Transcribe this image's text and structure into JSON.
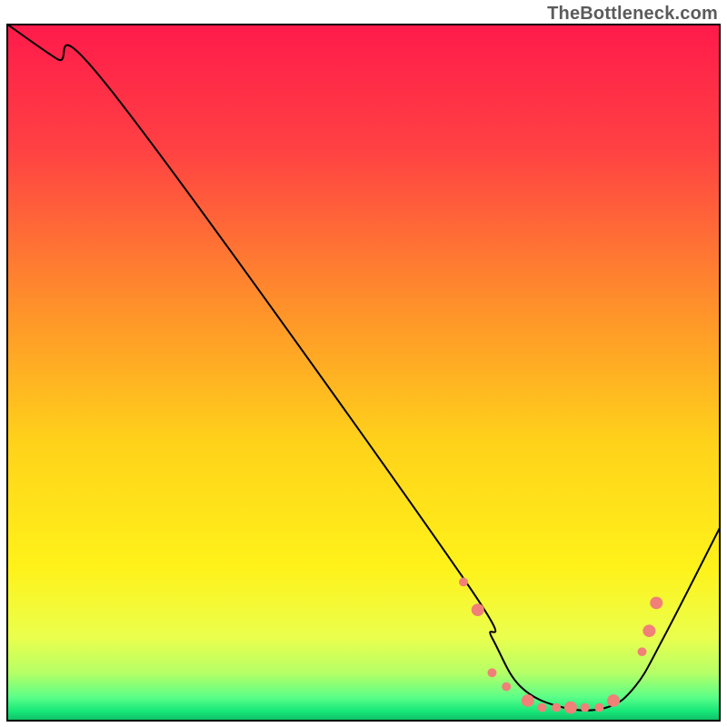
{
  "attribution": "TheBottleneck.com",
  "chart_data": {
    "type": "line",
    "title": "",
    "xlabel": "",
    "ylabel": "",
    "xlim": [
      0,
      100
    ],
    "ylim": [
      0,
      100
    ],
    "series": [
      {
        "name": "bottleneck-curve",
        "x": [
          0,
          7,
          15,
          63,
          68,
          72,
          78,
          84,
          88,
          92,
          100
        ],
        "values": [
          100,
          95,
          90,
          22,
          12,
          5,
          2,
          2,
          5,
          12,
          28
        ]
      }
    ],
    "markers": {
      "name": "highlight-dots",
      "color": "#f08078",
      "radius_small": 5,
      "radius_large": 7,
      "points": [
        {
          "x": 64,
          "y": 20,
          "r": "small"
        },
        {
          "x": 66,
          "y": 16,
          "r": "large"
        },
        {
          "x": 68,
          "y": 7,
          "r": "small"
        },
        {
          "x": 70,
          "y": 5,
          "r": "small"
        },
        {
          "x": 73,
          "y": 3,
          "r": "large"
        },
        {
          "x": 75,
          "y": 2,
          "r": "small"
        },
        {
          "x": 77,
          "y": 2,
          "r": "small"
        },
        {
          "x": 79,
          "y": 2,
          "r": "large"
        },
        {
          "x": 81,
          "y": 2,
          "r": "small"
        },
        {
          "x": 83,
          "y": 2,
          "r": "small"
        },
        {
          "x": 85,
          "y": 3,
          "r": "large"
        },
        {
          "x": 89,
          "y": 10,
          "r": "small"
        },
        {
          "x": 90,
          "y": 13,
          "r": "large"
        },
        {
          "x": 91,
          "y": 17,
          "r": "large"
        }
      ]
    },
    "background_gradient": {
      "type": "vertical",
      "stops": [
        {
          "offset": 0.0,
          "color": "#ff1a4b"
        },
        {
          "offset": 0.18,
          "color": "#ff4143"
        },
        {
          "offset": 0.4,
          "color": "#ff8f2b"
        },
        {
          "offset": 0.6,
          "color": "#ffd21a"
        },
        {
          "offset": 0.78,
          "color": "#fff21a"
        },
        {
          "offset": 0.88,
          "color": "#eaff4d"
        },
        {
          "offset": 0.93,
          "color": "#b6ff66"
        },
        {
          "offset": 0.965,
          "color": "#5bff88"
        },
        {
          "offset": 0.985,
          "color": "#17e879"
        },
        {
          "offset": 1.0,
          "color": "#0fb864"
        }
      ]
    }
  }
}
